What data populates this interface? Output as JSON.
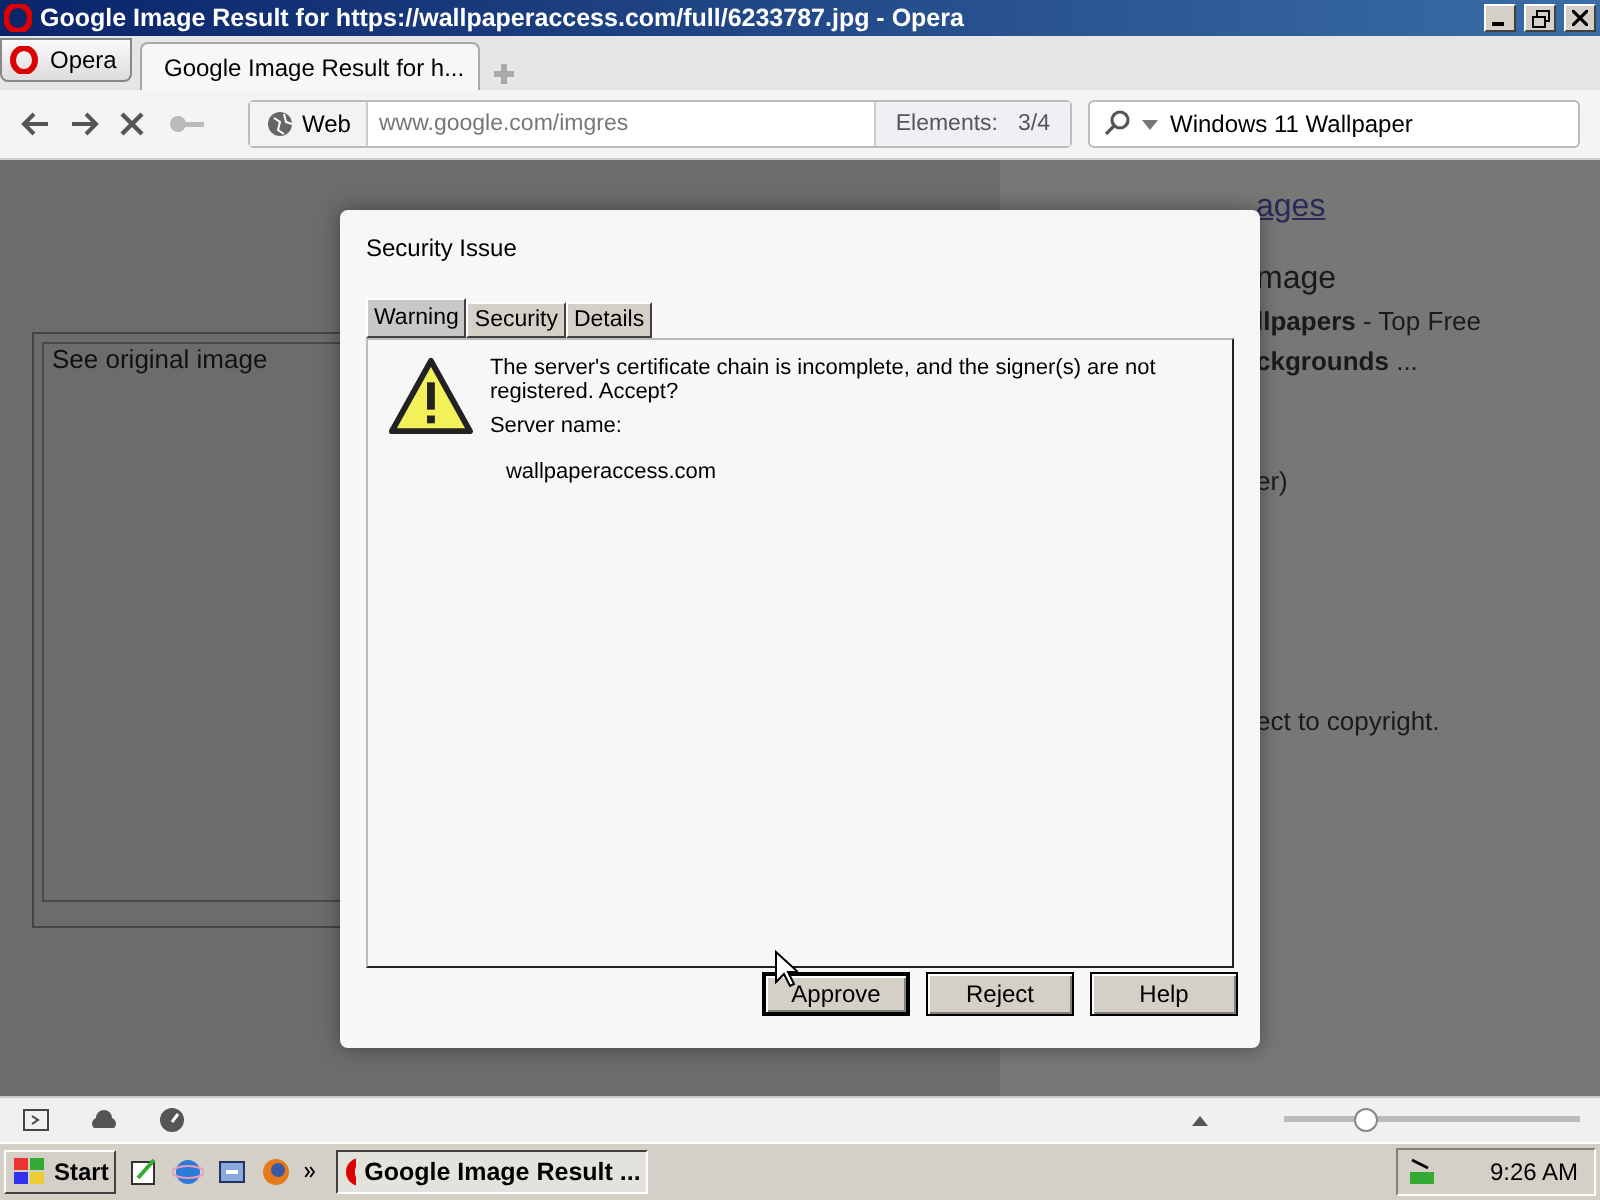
{
  "window": {
    "title": "Google Image Result for https://wallpaperaccess.com/full/6233787.jpg - Opera"
  },
  "menu_button": "Opera",
  "tabs": [
    {
      "label": "Google Image Result for h...",
      "selected": true
    }
  ],
  "address_bar": {
    "site_badge": "Web",
    "url": "www.google.com/imgres",
    "elements_label": "Elements:",
    "elements_value": "3/4"
  },
  "search": {
    "value": "Windows 11 Wallpaper"
  },
  "page": {
    "left_box": "See original image",
    "link": "ages",
    "right_lines": [
      "mage",
      "**llpapers** - Top Free",
      "**ckgrounds** ...",
      "er)",
      "ect to copyright."
    ]
  },
  "dialog": {
    "title": "Security Issue",
    "tabs": [
      {
        "label": "Warning",
        "selected": true
      },
      {
        "label": "Security",
        "selected": false
      },
      {
        "label": "Details",
        "selected": false
      }
    ],
    "message": "The server's certificate chain is incomplete, and the signer(s) are not registered. Accept?",
    "server_label": "Server name:",
    "server_name": "wallpaperaccess.com",
    "buttons": [
      {
        "label": "Approve",
        "default": true
      },
      {
        "label": "Reject",
        "default": false
      },
      {
        "label": "Help",
        "default": false
      }
    ]
  },
  "status_bar": {
    "zoom": {
      "level": 0.28
    }
  },
  "taskbar": {
    "start": "Start",
    "task": "Google Image Result ...",
    "clock": "9:26 AM"
  }
}
